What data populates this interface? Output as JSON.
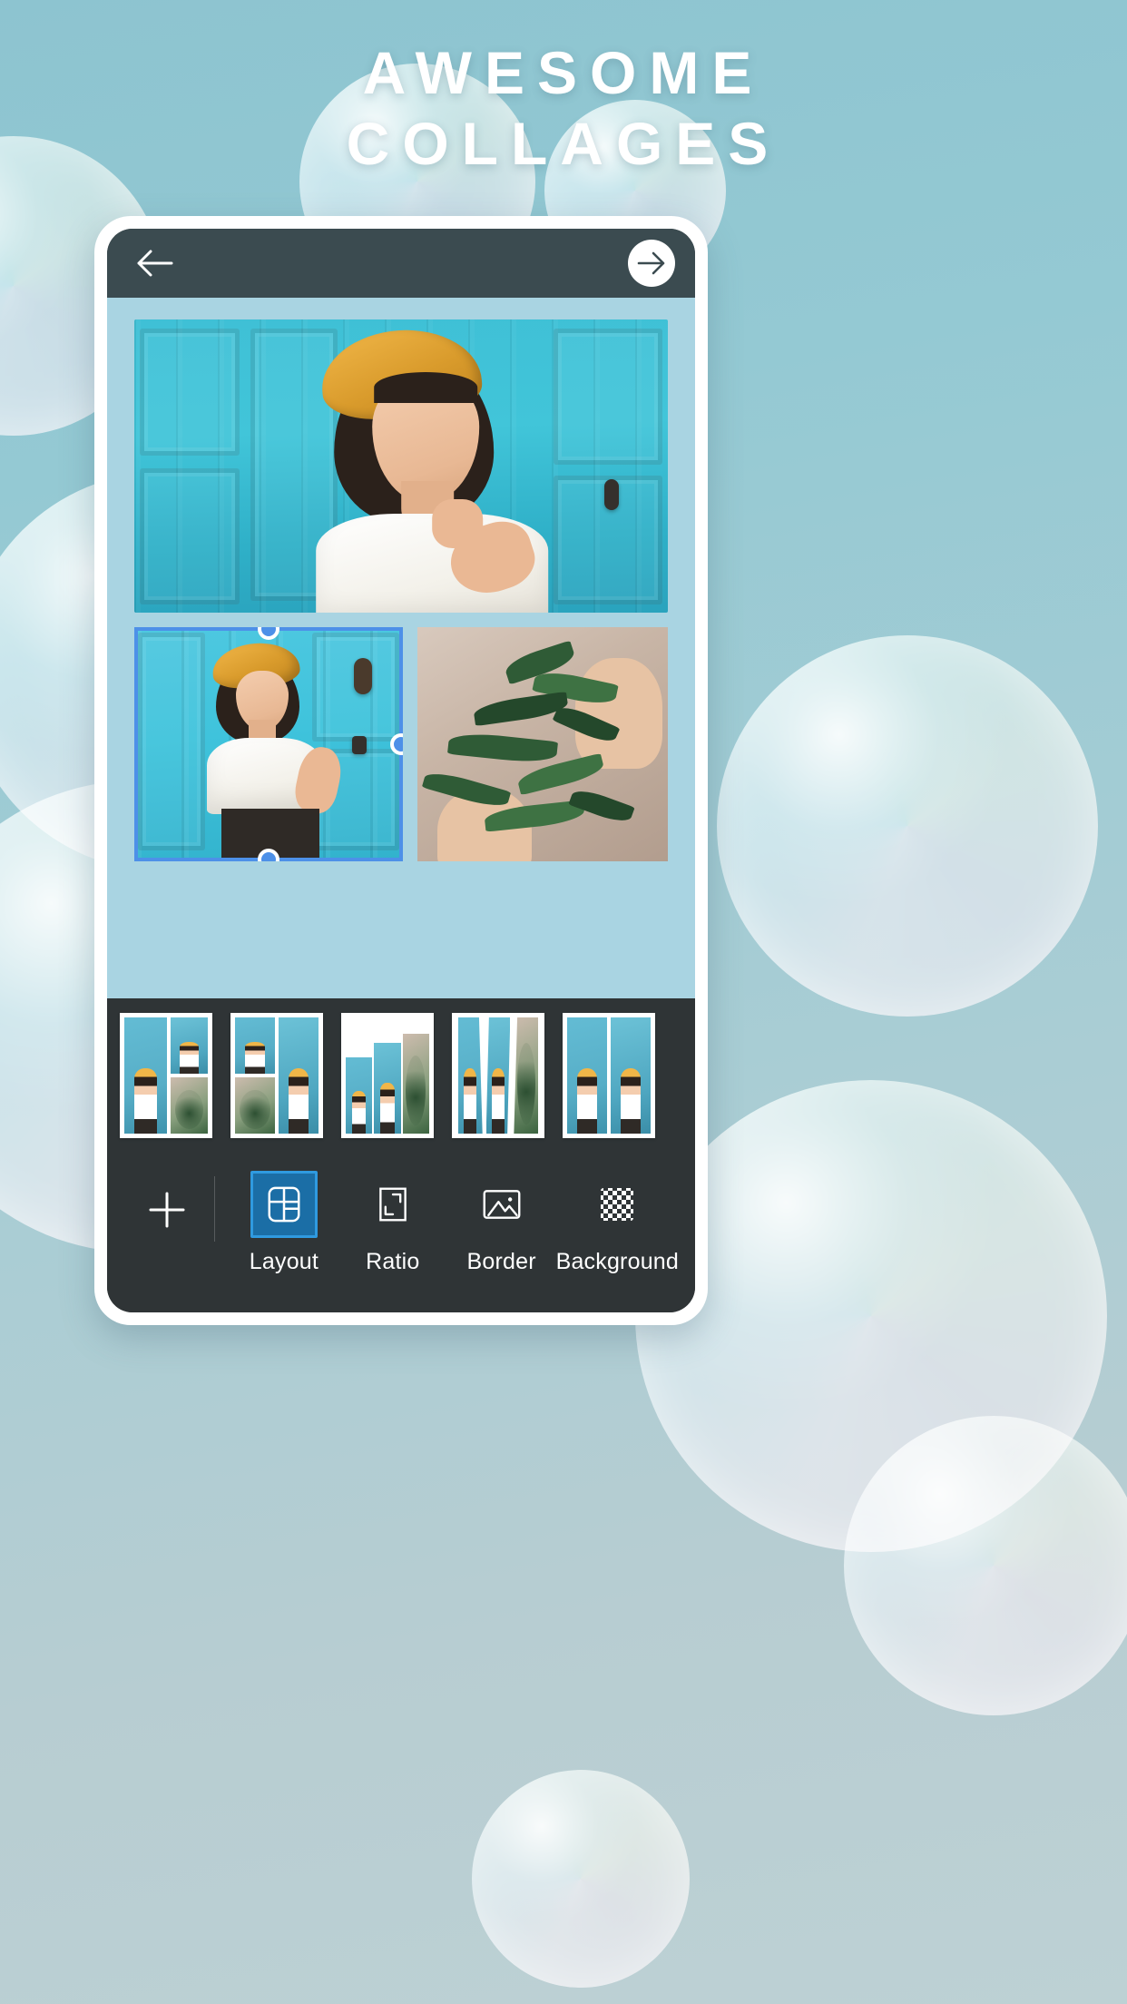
{
  "theme": {
    "page_bg": "#a9cdd4",
    "headline_color": "#ffffff",
    "navbar_bg": "#3b4b50",
    "canvas_bg": "#a9d4e2",
    "panel_bg": "#2f3436",
    "accent_blue": "#4d90e8",
    "active_tool_bg": "#1b6ea6",
    "active_tool_border": "#2f9ae0"
  },
  "headline": {
    "line1": "AWESOME",
    "line2": "COLLAGES"
  },
  "navbar": {
    "back_icon": "arrow-left-icon",
    "next_icon": "arrow-right-icon"
  },
  "canvas": {
    "cells": [
      {
        "id": "cell-top",
        "label": "portrait-smiling-hand-on-chin",
        "selected": false
      },
      {
        "id": "cell-left",
        "label": "portrait-hand-on-hip-blue-door",
        "selected": true
      },
      {
        "id": "cell-right",
        "label": "hands-holding-olive-branch",
        "selected": false
      }
    ],
    "selection": {
      "handles": [
        "top",
        "right",
        "bottom"
      ]
    }
  },
  "templates": [
    {
      "name": "layout-template-1",
      "selected": false
    },
    {
      "name": "layout-template-2",
      "selected": false
    },
    {
      "name": "layout-template-3",
      "selected": false
    },
    {
      "name": "layout-template-4",
      "selected": false
    },
    {
      "name": "layout-template-5",
      "selected": false
    }
  ],
  "toolbar": {
    "add_icon": "plus-icon",
    "tools": [
      {
        "label": "Layout",
        "icon": "layout-grid-icon",
        "active": true
      },
      {
        "label": "Ratio",
        "icon": "aspect-ratio-icon",
        "active": false
      },
      {
        "label": "Border",
        "icon": "image-icon",
        "active": false
      },
      {
        "label": "Background",
        "icon": "checkerboard-icon",
        "active": false
      }
    ]
  }
}
